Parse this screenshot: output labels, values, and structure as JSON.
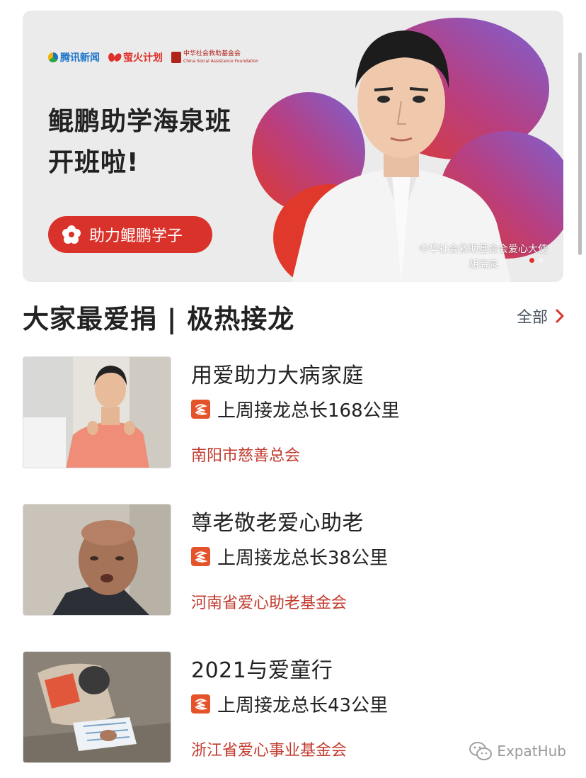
{
  "banner": {
    "logos": {
      "tencent": "腾讯新闻",
      "firefly": "萤火计划",
      "fund": "中华社会救助基金会",
      "fund_en": "China Social Assistance Foundation"
    },
    "title_line1": "鲲鹏助学海泉班",
    "title_line2": "开班啦!",
    "button_label": "助力鲲鹏学子",
    "credit_line1": "中华社会救助基金会爱心大使",
    "credit_line2": "胡海泉",
    "active_slide": 1,
    "slide_count": 2
  },
  "section": {
    "title": "大家最爱捐 | 极热接龙",
    "see_all_label": "全部"
  },
  "projects": [
    {
      "title": "用爱助力大病家庭",
      "stat": "上周接龙总长168公里",
      "org": "南阳市慈善总会",
      "thumb_icon": "child-photo"
    },
    {
      "title": "尊老敬老爱心助老",
      "stat": "上周接龙总长38公里",
      "org": "河南省爱心助老基金会",
      "thumb_icon": "elderly-man-photo"
    },
    {
      "title": "2021与爱童行",
      "stat": "上周接龙总长43公里",
      "org": "浙江省爱心事业基金会",
      "thumb_icon": "child-writing-photo"
    }
  ],
  "watermark": {
    "label": "ExpatHub"
  },
  "colors": {
    "accent_red": "#d9322a",
    "org_red": "#c23a2e",
    "petal_purple": "#7b62d4",
    "petal_red": "#e0392c"
  }
}
